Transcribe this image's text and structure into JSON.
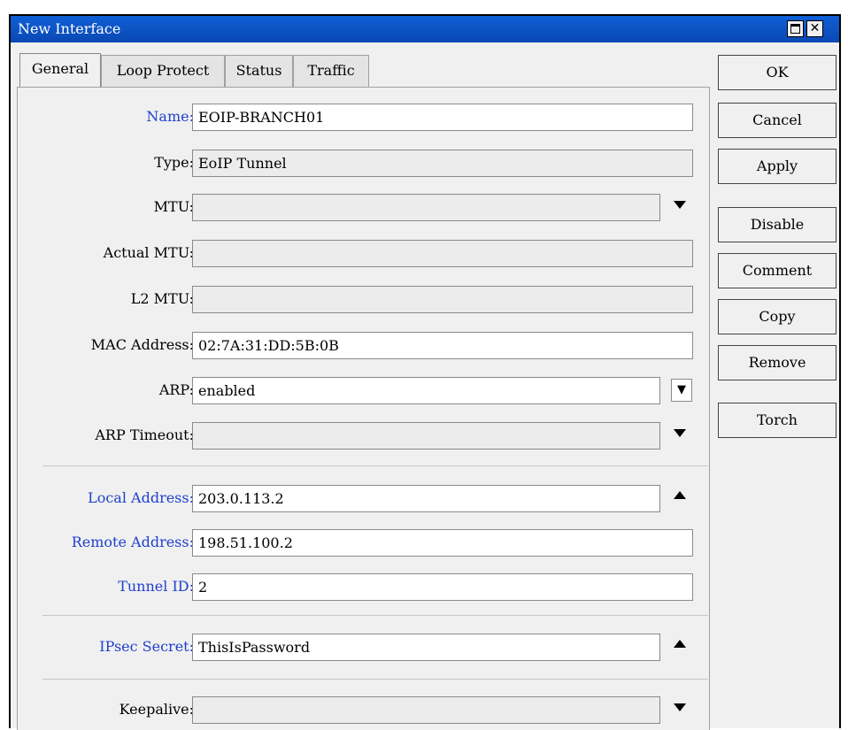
{
  "window": {
    "title": "New Interface"
  },
  "tabs": [
    "General",
    "Loop Protect",
    "Status",
    "Traffic"
  ],
  "fields": {
    "name": {
      "label": "Name:",
      "value": "EOIP-BRANCH01"
    },
    "type": {
      "label": "Type:",
      "value": "EoIP Tunnel"
    },
    "mtu": {
      "label": "MTU:",
      "value": ""
    },
    "actual_mtu": {
      "label": "Actual MTU:",
      "value": ""
    },
    "l2_mtu": {
      "label": "L2 MTU:",
      "value": ""
    },
    "mac_address": {
      "label": "MAC Address:",
      "value": "02:7A:31:DD:5B:0B"
    },
    "arp": {
      "label": "ARP:",
      "value": "enabled"
    },
    "arp_timeout": {
      "label": "ARP Timeout:",
      "value": ""
    },
    "local_address": {
      "label": "Local Address:",
      "value": "203.0.113.2"
    },
    "remote_address": {
      "label": "Remote Address:",
      "value": "198.51.100.2"
    },
    "tunnel_id": {
      "label": "Tunnel ID:",
      "value": "2"
    },
    "ipsec_secret": {
      "label": "IPsec Secret:",
      "value": "ThisIsPassword"
    },
    "keepalive": {
      "label": "Keepalive:",
      "value": ""
    }
  },
  "buttons": {
    "ok": "OK",
    "cancel": "Cancel",
    "apply": "Apply",
    "disable": "Disable",
    "comment": "Comment",
    "copy": "Copy",
    "remove": "Remove",
    "torch": "Torch"
  },
  "colors": {
    "titlebar": "#0a48b4",
    "required_label": "#1f3fcf"
  },
  "icons": {
    "window_maximize": "maximize-icon",
    "window_close": "close-icon",
    "expand": "triangle-down-icon",
    "collapse": "triangle-up-icon",
    "dropdown": "dropdown-arrow-icon"
  }
}
